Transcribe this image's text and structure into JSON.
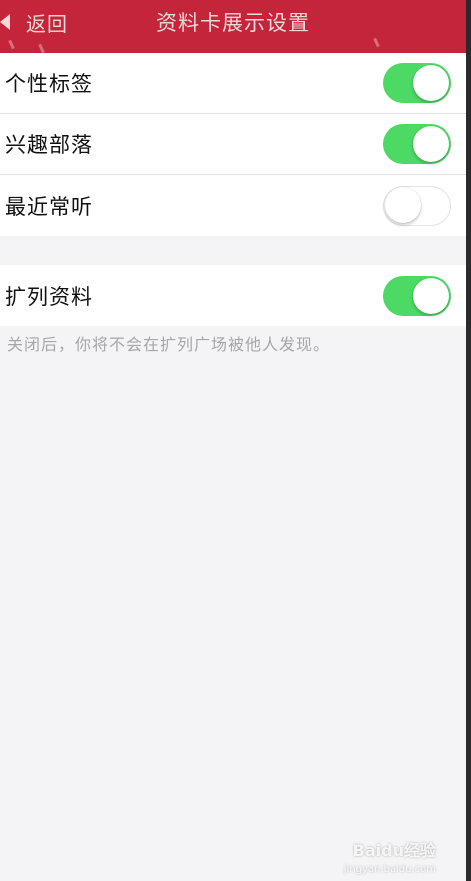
{
  "header": {
    "back_label": "返回",
    "title": "资料卡展示设置"
  },
  "profile_group": [
    {
      "label": "个性标签",
      "on": true
    },
    {
      "label": "兴趣部落",
      "on": true
    },
    {
      "label": "最近常听",
      "on": false
    }
  ],
  "extend_group": [
    {
      "label": "扩列资料",
      "on": true
    }
  ],
  "footnote": "关闭后，你将不会在扩列广场被他人发现。",
  "watermark": {
    "brand": "Baidu经验",
    "url": "jingyan.baidu.com"
  },
  "colors": {
    "nav_bg": "#c5253a",
    "toggle_on": "#4cd964",
    "toggle_off": "#ffffff"
  }
}
